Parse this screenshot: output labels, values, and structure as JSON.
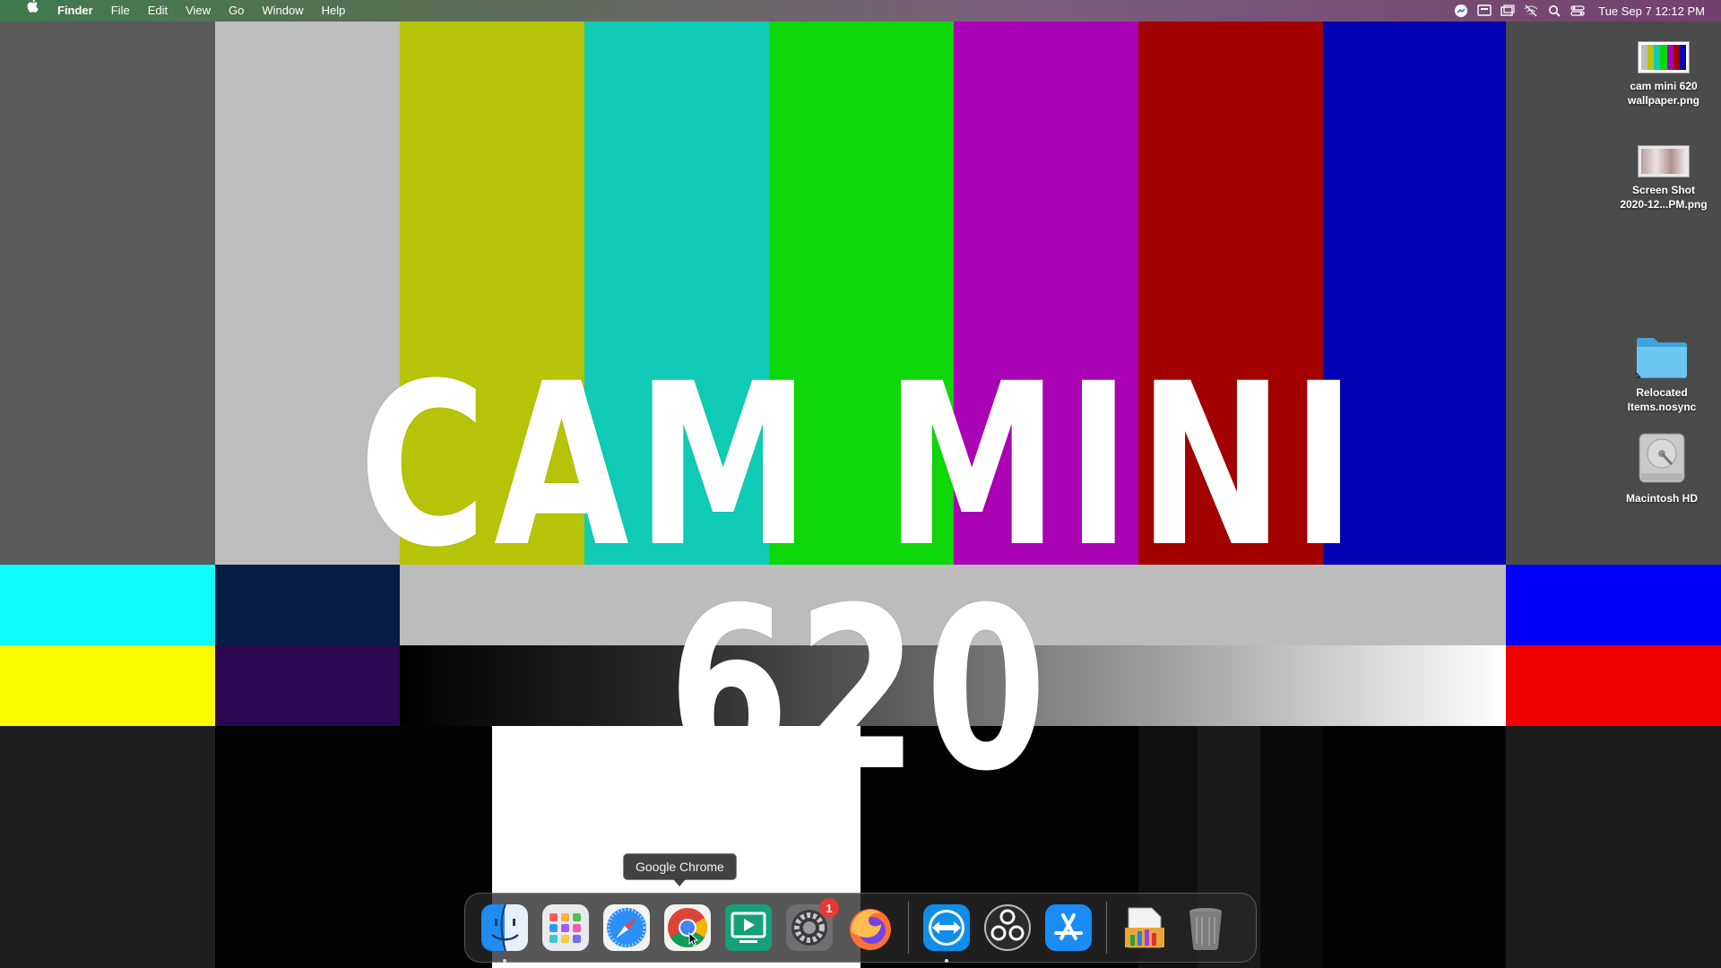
{
  "menubar": {
    "apple": "",
    "app_name": "Finder",
    "items": [
      "File",
      "Edit",
      "View",
      "Go",
      "Window",
      "Help"
    ],
    "clock": "Tue Sep 7  12:12 PM",
    "status_icons": [
      "messenger-icon",
      "display-icon",
      "screen-mirroring-icon",
      "wifi-off-icon",
      "search-icon",
      "control-center-icon"
    ]
  },
  "wallpaper": {
    "title": "CAM MINI 620",
    "top_bars": [
      "#bdbdbd",
      "#b6c408",
      "#10cbb5",
      "#0ed709",
      "#aa03b5",
      "#a30000",
      "#0201b3"
    ],
    "colors": {
      "left_gray": "#5a5a5a",
      "right_gray": "#4b4b4b",
      "cyan": "#0dfdfd",
      "navy": "#061d44",
      "mid_gray": "#bcbcbc",
      "blue": "#0200f6",
      "yellow": "#fbfb00",
      "purple": "#2b0851",
      "red": "#f00101"
    }
  },
  "desktop": {
    "icons": [
      {
        "name": "cam-mini-wallpaper",
        "label": "cam mini 620\nwallpaper.png",
        "kind": "image"
      },
      {
        "name": "screen-shot",
        "label": "Screen Shot\n2020-12...PM.png",
        "kind": "image"
      },
      {
        "name": "relocated-items",
        "label": "Relocated\nItems.nosync",
        "kind": "folder"
      },
      {
        "name": "macintosh-hd",
        "label": "Macintosh HD",
        "kind": "disk"
      }
    ]
  },
  "dock": {
    "tooltip": "Google Chrome",
    "apps": [
      {
        "name": "finder-icon",
        "label": "Finder"
      },
      {
        "name": "launchpad-icon",
        "label": "Launchpad"
      },
      {
        "name": "safari-icon",
        "label": "Safari"
      },
      {
        "name": "chrome-icon",
        "label": "Google Chrome"
      },
      {
        "name": "screen-share-icon",
        "label": "Screen Share"
      },
      {
        "name": "system-preferences-icon",
        "label": "System Preferences",
        "badge": "1"
      },
      {
        "name": "firefox-icon",
        "label": "Firefox"
      },
      {
        "name": "teamviewer-icon",
        "label": "TeamViewer"
      },
      {
        "name": "obs-icon",
        "label": "OBS"
      },
      {
        "name": "app-store-icon",
        "label": "App Store"
      },
      {
        "name": "downloads-stack-icon",
        "label": "Downloads"
      },
      {
        "name": "trash-icon",
        "label": "Trash"
      }
    ]
  }
}
